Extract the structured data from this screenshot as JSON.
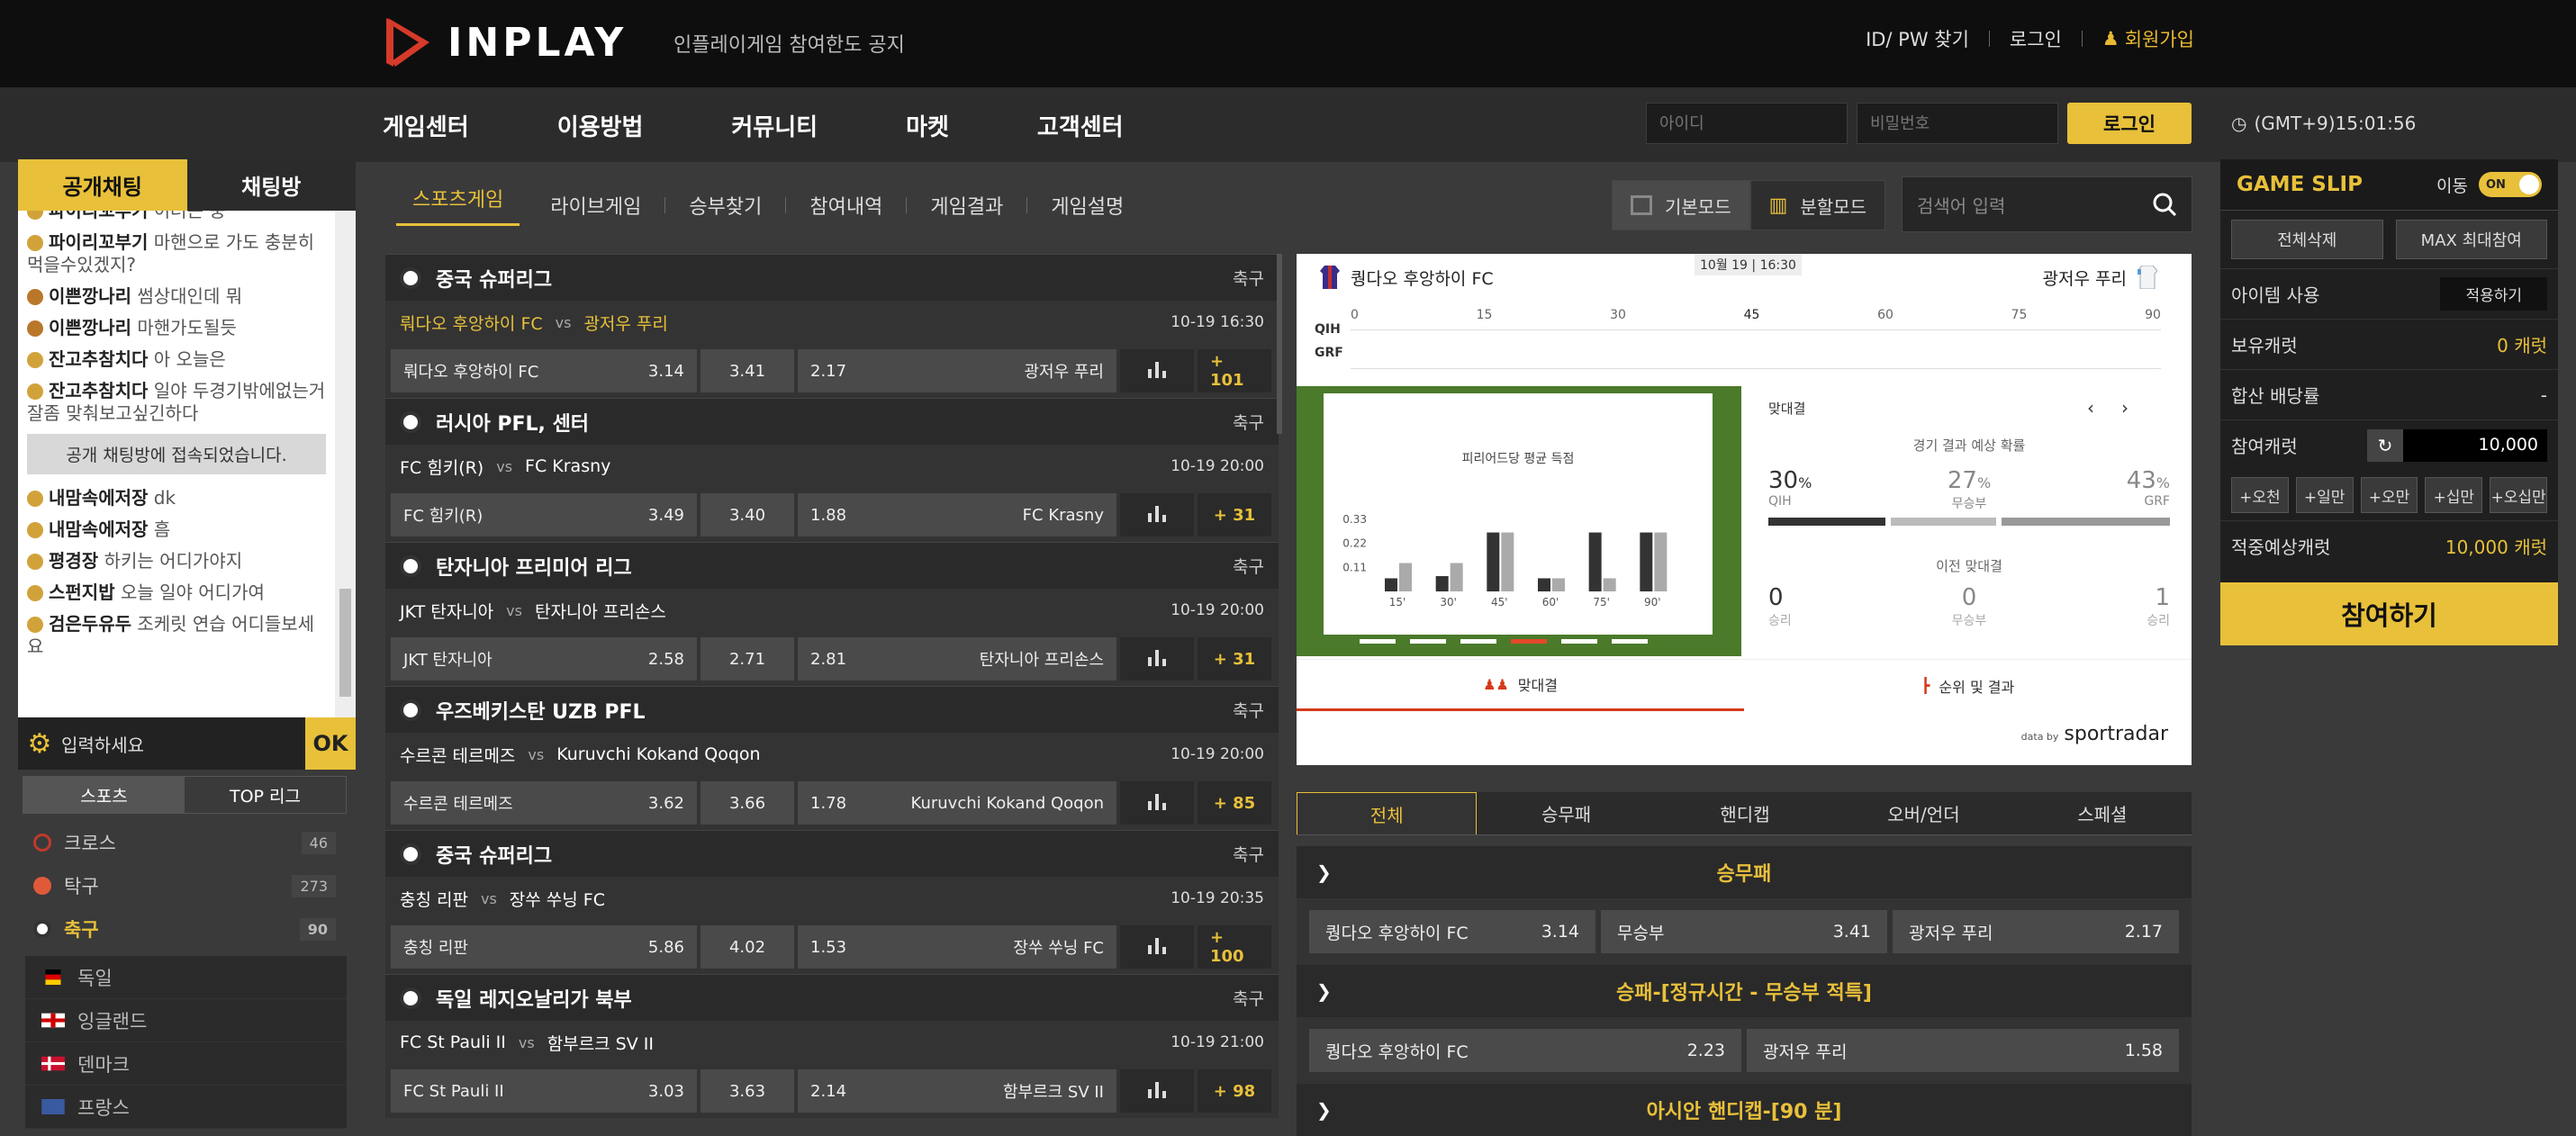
{
  "header": {
    "logo_text": "INPLAY",
    "notice": "인플레이게임 참여한도 공지",
    "find_id_pw": "ID/ PW 찾기",
    "login_link": "로그인",
    "join_link": "회원가입"
  },
  "nav": {
    "items": [
      "게임센터",
      "이용방법",
      "커뮤니티",
      "마켓",
      "고객센터"
    ],
    "id_placeholder": "아이디",
    "pw_placeholder": "비밀번호",
    "login_button": "로그인",
    "clock": "(GMT+9)15:01:56"
  },
  "chat": {
    "tab_public": "공개채팅",
    "tab_room": "채팅방",
    "messages": [
      {
        "nick": "파이리꼬부기",
        "text": "이러는 중"
      },
      {
        "nick": "파이리꼬부기",
        "text": "마핸으로 가도 충분히 먹을수있겠지?"
      },
      {
        "nick": "이쁜깡나리",
        "text": "썸상대인데 뭐"
      },
      {
        "nick": "이쁜깡나리",
        "text": "마핸가도될듯"
      },
      {
        "nick": "잔고추참치다",
        "text": "아 오늘은"
      },
      {
        "nick": "잔고추참치다",
        "text": "일야 두경기밖에없는거 잘좀 맞춰보고싶긴하다"
      }
    ],
    "system_message": "공개 채팅방에 접속되었습니다.",
    "messages2": [
      {
        "nick": "내맘속에저장",
        "text": "dk"
      },
      {
        "nick": "내맘속에저장",
        "text": "흠"
      },
      {
        "nick": "평경장",
        "text": "하키는 어디가야지"
      },
      {
        "nick": "스펀지밥",
        "text": "오늘 일야 어디가여"
      },
      {
        "nick": "검은두유두",
        "text": "조케릿 연습 어디들보세요"
      }
    ],
    "input_placeholder": "입력하세요",
    "ok": "OK"
  },
  "sports": {
    "tab_sports": "스포츠",
    "tab_top": "TOP 리그",
    "items": [
      {
        "name": "크로스",
        "count": "46",
        "color": "#c0392b"
      },
      {
        "name": "탁구",
        "count": "273",
        "color": "#e05a3a"
      },
      {
        "name": "축구",
        "count": "90",
        "color": "#ffffff"
      }
    ],
    "countries": [
      "독일",
      "잉글랜드",
      "덴마크",
      "프랑스"
    ]
  },
  "subnav": {
    "items": [
      "스포츠게임",
      "라이브게임",
      "승부찾기",
      "참여내역",
      "게임결과",
      "게임설명"
    ],
    "mode_basic": "기본모드",
    "mode_split": "분할모드",
    "search_placeholder": "검색어 입력"
  },
  "games": [
    {
      "league": "중국 슈퍼리그",
      "type": "축구",
      "home": "뤄다오 후앙하이 FC",
      "away": "광저우 푸리",
      "time": "10-19 16:30",
      "o1": "3.14",
      "ox": "3.41",
      "o2": "2.17",
      "more": "+ 101",
      "hl": true
    },
    {
      "league": "러시아 PFL, 센터",
      "type": "축구",
      "home": "FC 힘키(R)",
      "away": "FC Krasny",
      "time": "10-19 20:00",
      "o1": "3.49",
      "ox": "3.40",
      "o2": "1.88",
      "more": "+ 31",
      "hl": false
    },
    {
      "league": "탄자니아 프리미어 리그",
      "type": "축구",
      "home": "JKT 탄자니아",
      "away": "탄자니아 프리손스",
      "time": "10-19 20:00",
      "o1": "2.58",
      "ox": "2.71",
      "o2": "2.81",
      "more": "+ 31",
      "hl": false
    },
    {
      "league": "우즈베키스탄 UZB PFL",
      "type": "축구",
      "home": "수르콘 테르메즈",
      "away": "Kuruvchi Kokand Qoqon",
      "time": "10-19 20:00",
      "o1": "3.62",
      "ox": "3.66",
      "o2": "1.78",
      "more": "+ 85",
      "hl": false
    },
    {
      "league": "중국 슈퍼리그",
      "type": "축구",
      "home": "충칭 리판",
      "away": "장쑤 쑤닝 FC",
      "time": "10-19 20:35",
      "o1": "5.86",
      "ox": "4.02",
      "o2": "1.53",
      "more": "+ 100",
      "hl": false
    },
    {
      "league": "독일 레지오날리가 북부",
      "type": "축구",
      "home": "FC St Pauli II",
      "away": "함부르크 SV II",
      "time": "10-19 21:00",
      "o1": "3.03",
      "ox": "3.63",
      "o2": "2.14",
      "more": "+ 98",
      "hl": false
    }
  ],
  "tracker": {
    "home": "퀑다오 후앙하이 FC",
    "away": "광저우 푸리",
    "date": "10월 19 | 16:30",
    "ticks": [
      "0",
      "15",
      "30",
      "45",
      "60",
      "75",
      "90"
    ],
    "row1": "QIH",
    "row2": "GRF",
    "chart_title": "피리어드당 평균 득점",
    "h2h_label": "맞대결",
    "prob_title": "경기 결과 예상 확률",
    "prob_home": "30",
    "prob_draw": "27",
    "prob_away": "43",
    "pct": "%",
    "lbl_home": "QIH",
    "lbl_draw": "무승부",
    "lbl_away": "GRF",
    "prev_title": "이전 맞대결",
    "prev_home": "0",
    "prev_draw": "0",
    "prev_away": "1",
    "prev_lbl_win": "승리",
    "prev_lbl_draw": "무승부",
    "tab_h2h": "맞대결",
    "tab_rank": "순위 및 결과",
    "data_by": "data by",
    "brand": "sportradar"
  },
  "chart_data": {
    "type": "bar",
    "title": "피리어드당 평균 득점",
    "categories": [
      "15'",
      "30'",
      "45'",
      "60'",
      "75'",
      "90'"
    ],
    "series": [
      {
        "values": [
          0.06,
          0.07,
          0.27,
          0.06,
          0.27,
          0.27
        ]
      },
      {
        "values": [
          0.13,
          0.13,
          0.27,
          0.06,
          0.06,
          0.27
        ]
      }
    ],
    "yticks": [
      "0.33",
      "0.22",
      "0.11"
    ],
    "ylim": [
      0,
      0.33
    ]
  },
  "bettabs": [
    "전체",
    "승무패",
    "핸디캡",
    "오버/언더",
    "스페셜"
  ],
  "markets": [
    {
      "title": "승무패",
      "odds": [
        [
          "퀑다오 후앙하이 FC",
          "3.14"
        ],
        [
          "무승부",
          "3.41"
        ],
        [
          "광저우 푸리",
          "2.17"
        ]
      ]
    },
    {
      "title": "승패-[정규시간 - 무승부 적특]",
      "odds": [
        [
          "퀑다오 후앙하이 FC",
          "2.23"
        ],
        [
          "광저우 푸리",
          "1.58"
        ]
      ]
    },
    {
      "title": "아시안 핸디캡-[90 분]",
      "odds": []
    }
  ],
  "slip": {
    "title": "GAME SLIP",
    "move": "이동",
    "toggle": "ON",
    "clear_all": "전체삭제",
    "max_bet": "MAX 최대참여",
    "item_use": "아이템 사용",
    "apply": "적용하기",
    "owned_label": "보유캐럿",
    "owned_value": "0 캐럿",
    "combined_label": "합산 배당률",
    "combined_value": "-",
    "bet_label": "참여캐럿",
    "bet_amount": "10,000",
    "quick": [
      "+오천",
      "+일만",
      "+오만",
      "+십만",
      "+오십만"
    ],
    "expected_label": "적중예상캐럿",
    "expected_value": "10,000 캐럿",
    "submit": "참여하기"
  }
}
